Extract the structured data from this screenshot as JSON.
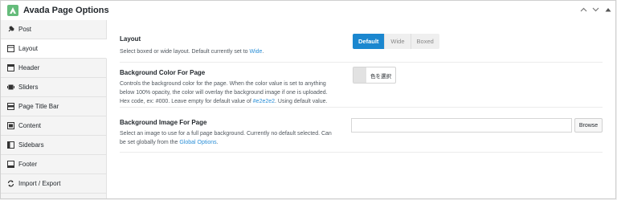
{
  "header": {
    "title": "Avada Page Options",
    "icons": [
      "chevron-up-icon",
      "chevron-down-icon",
      "collapse-arrow-icon"
    ]
  },
  "sidebar": {
    "items": [
      {
        "label": "Post",
        "icon": "pushpin-icon"
      },
      {
        "label": "Layout",
        "icon": "layout-icon"
      },
      {
        "label": "Header",
        "icon": "header-icon"
      },
      {
        "label": "Sliders",
        "icon": "sliders-icon"
      },
      {
        "label": "Page Title Bar",
        "icon": "titlebar-icon"
      },
      {
        "label": "Content",
        "icon": "content-icon"
      },
      {
        "label": "Sidebars",
        "icon": "sidebars-icon"
      },
      {
        "label": "Footer",
        "icon": "footer-icon"
      },
      {
        "label": "Import / Export",
        "icon": "import-export-icon"
      }
    ]
  },
  "layout_option": {
    "title": "Layout",
    "desc_before": "Select boxed or wide layout. Default currently set to ",
    "desc_link": "Wide",
    "desc_after": ".",
    "options": [
      "Default",
      "Wide",
      "Boxed"
    ],
    "selected": "Default"
  },
  "bg_color_option": {
    "title": "Background Color For Page",
    "desc_before": "Controls the background color for the page. When the color value is set to anything below 100% opacity, the color will overlay the background image if one is uploaded. Hex code, ex: #000. Leave empty for default value of ",
    "desc_highlight": "#e2e2e2",
    "desc_after": ". Using default value.",
    "button_label": "色を選択",
    "swatch_color": "#e2e2e2"
  },
  "bg_image_option": {
    "title": "Background Image For Page",
    "desc_before": "Select an image to use for a full page background. Currently no default selected. Can be set globally from the ",
    "desc_link": "Global Options",
    "desc_after": ".",
    "input_value": "",
    "browse_label": "Browse"
  }
}
